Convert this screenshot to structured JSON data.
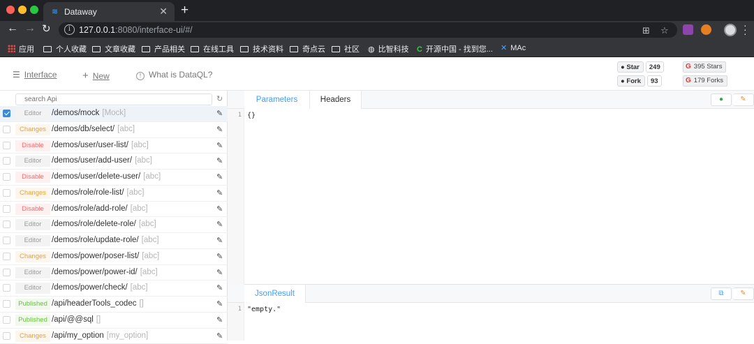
{
  "browser": {
    "tab_title": "Dataway",
    "new_tab_icon": "+",
    "url_host": "127.0.0.1",
    "url_path": ":8080/interface-ui/#/",
    "bookmarks": [
      "应用",
      "个人收藏",
      "文章收藏",
      "产品相关",
      "在线工具",
      "技术资料",
      "奇点云",
      "社区",
      "比智科技",
      "开源中国 - 找到您...",
      "MAc"
    ]
  },
  "header": {
    "nav": [
      {
        "icon": "list-icon",
        "label": "Interface"
      },
      {
        "icon": "plus-icon",
        "label": "New"
      },
      {
        "icon": "info-icon",
        "label": "What is DataQL?"
      }
    ],
    "github": [
      {
        "label": "Star",
        "count": "249"
      },
      {
        "label": "Fork",
        "count": "93"
      }
    ],
    "gitee": [
      {
        "label": "395 Stars"
      },
      {
        "label": "179 Forks"
      }
    ]
  },
  "sidebar": {
    "search_placeholder": "search Api",
    "apis": [
      {
        "status": "Editor",
        "path": "/demos/mock",
        "comment": "[Mock]",
        "selected": true
      },
      {
        "status": "Changes",
        "path": "/demos/db/select/",
        "comment": "[abc]",
        "selected": false
      },
      {
        "status": "Disable",
        "path": "/demos/user/user-list/",
        "comment": "[abc]",
        "selected": false
      },
      {
        "status": "Editor",
        "path": "/demos/user/add-user/",
        "comment": "[abc]",
        "selected": false
      },
      {
        "status": "Disable",
        "path": "/demos/user/delete-user/",
        "comment": "[abc]",
        "selected": false
      },
      {
        "status": "Changes",
        "path": "/demos/role/role-list/",
        "comment": "[abc]",
        "selected": false
      },
      {
        "status": "Disable",
        "path": "/demos/role/add-role/",
        "comment": "[abc]",
        "selected": false
      },
      {
        "status": "Editor",
        "path": "/demos/role/delete-role/",
        "comment": "[abc]",
        "selected": false
      },
      {
        "status": "Editor",
        "path": "/demos/role/update-role/",
        "comment": "[abc]",
        "selected": false
      },
      {
        "status": "Changes",
        "path": "/demos/power/poser-list/",
        "comment": "[abc]",
        "selected": false
      },
      {
        "status": "Editor",
        "path": "/demos/power/power-id/",
        "comment": "[abc]",
        "selected": false
      },
      {
        "status": "Editor",
        "path": "/demos/power/check/",
        "comment": "[abc]",
        "selected": false
      },
      {
        "status": "Published",
        "path": "/api/headerTools_codec",
        "comment": "[]",
        "selected": false
      },
      {
        "status": "Published",
        "path": "/api/@@sql",
        "comment": "[]",
        "selected": false
      },
      {
        "status": "Changes",
        "path": "/api/my_option",
        "comment": "[my_option]",
        "selected": false
      }
    ]
  },
  "request_panel": {
    "tabs": [
      "Parameters",
      "Headers"
    ],
    "line_number": "1",
    "code": "{}"
  },
  "result_panel": {
    "tab": "JsonResult",
    "line_number": "1",
    "code": "\"empty.\""
  }
}
